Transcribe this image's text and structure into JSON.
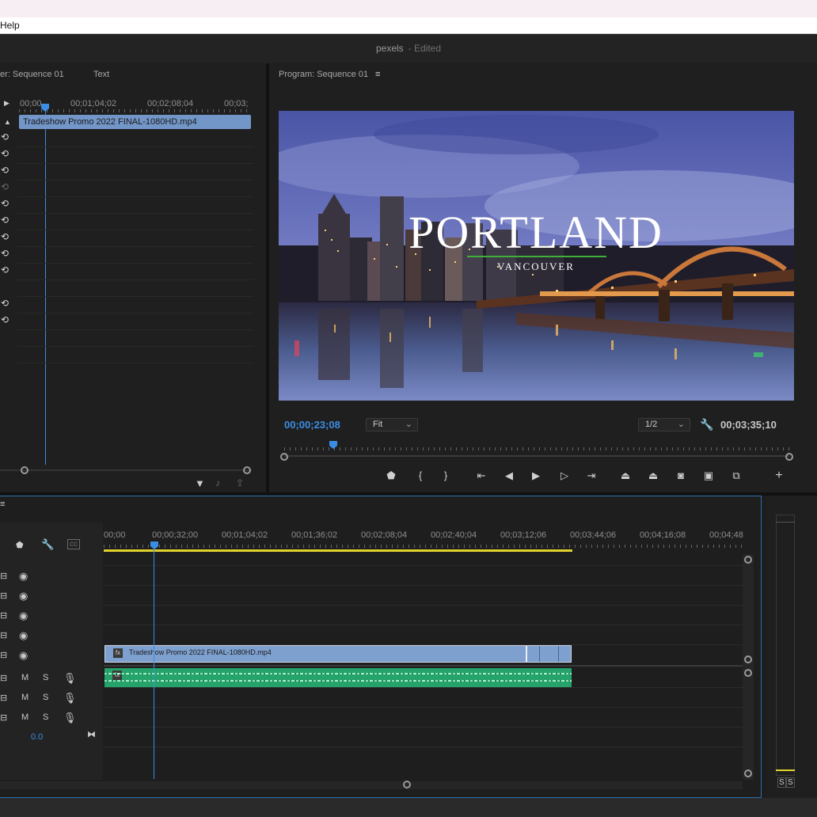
{
  "menu": {
    "help_label": "Help"
  },
  "window": {
    "project_name": "pexels",
    "status": "- Edited"
  },
  "source_panel": {
    "tab_source": "er: Sequence 01",
    "tab_text": "Text",
    "ruler": [
      "00;00",
      "00;01;04;02",
      "00;02;08;04",
      "00;03;"
    ],
    "clip_name": "Tradeshow Promo 2022 FINAL-1080HD.mp4"
  },
  "program": {
    "title": "Program: Sequence 01",
    "video_title": "PORTLAND",
    "video_subtitle": "VANCOUVER",
    "timecode_current": "00;00;23;08",
    "timecode_duration": "00;03;35;10",
    "zoom": "Fit",
    "resolution": "1/2"
  },
  "timeline": {
    "ruler": [
      "00;00",
      "00;00;32;00",
      "00;01;04;02",
      "00;01;36;02",
      "00;02;08;04",
      "00;02;40;04",
      "00;03;12;06",
      "00;03;44;06",
      "00;04;16;08",
      "00;04;48"
    ],
    "clip_name": "Tradeshow Promo 2022 FINAL-1080HD.mp4",
    "mute_label": "M",
    "solo_label": "S",
    "volume": "0.0"
  },
  "meters": {
    "solo_left": "S",
    "solo_right": "S"
  },
  "colors": {
    "accent": "#3b8de3",
    "video_clip": "#7ea0cf",
    "audio_clip": "#26a36b",
    "workarea": "#e1d22c"
  }
}
